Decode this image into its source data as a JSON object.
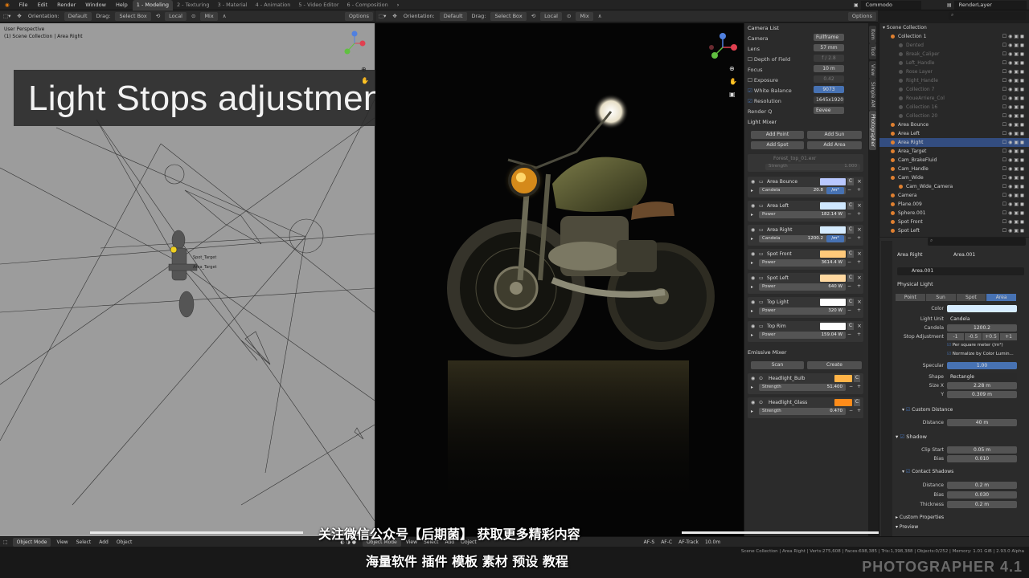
{
  "topbar": {
    "menus": [
      "File",
      "Edit",
      "Render",
      "Window",
      "Help"
    ],
    "tabs": [
      "1 - Modeling",
      "2 - Texturing",
      "3 - Material",
      "4 - Animation",
      "5 - Video Editor",
      "6 - Composition"
    ],
    "scene": "Commodo",
    "render_layer": "RenderLayer"
  },
  "viewport_header": {
    "orientation_label": "Orientation:",
    "orientation_value": "Default",
    "drag_label": "Drag:",
    "drag_value": "Select Box",
    "pivot_value": "Local",
    "snap_value": "Mix",
    "options": "Options"
  },
  "left_viewport": {
    "info_line1": "User Perspective",
    "info_line2": "(1) Scene Collection | Area Right",
    "target_label_1": "Spot_Target",
    "target_label_2": "Area_Target"
  },
  "overlay_title": "Light Stops adjustments",
  "camera_panel": {
    "camera_list": "Camera List",
    "camera_label": "Camera",
    "camera_value": "Fullframe",
    "lens_label": "Lens",
    "lens_value": "57 mm",
    "dof_label": "Depth of Field",
    "dof_value": "f / 2.8",
    "focus_label": "Focus",
    "focus_value": "10 m",
    "exposure_label": "Exposure",
    "exposure_value": "0.42",
    "wb_label": "White Balance",
    "wb_value": "9073",
    "resolution_label": "Resolution",
    "resolution_value": "1645x1920",
    "render_label": "Render Q",
    "render_value": "Eevee"
  },
  "light_mixer": {
    "title": "Light Mixer",
    "add_point": "Add Point",
    "add_sun": "Add Sun",
    "add_spot": "Add Spot",
    "add_area": "Add Area",
    "world_name": "Forest_top_01.exr",
    "world_strength_label": "Strength",
    "world_strength_value": "1.000",
    "lights": [
      {
        "name": "Area Bounce",
        "param": "Candela",
        "value": "20.8",
        "unit": "/m²",
        "color": "#b9c8ff"
      },
      {
        "name": "Area Left",
        "param": "Power",
        "value": "182.14 W",
        "unit": "",
        "color": "#cfe8ff"
      },
      {
        "name": "Area Right",
        "param": "Candela",
        "value": "1200.2",
        "unit": "/m²",
        "color": "#d6ecff"
      },
      {
        "name": "Spot Front",
        "param": "Power",
        "value": "3614.4 W",
        "unit": "",
        "color": "#ffc97a"
      },
      {
        "name": "Spot Left",
        "param": "Power",
        "value": "640 W",
        "unit": "",
        "color": "#ffd8a0"
      },
      {
        "name": "Top Light",
        "param": "Power",
        "value": "320 W",
        "unit": "",
        "color": "#ffffff"
      },
      {
        "name": "Top Rim",
        "param": "Power",
        "value": "159.04 W",
        "unit": "",
        "color": "#ffffff"
      }
    ]
  },
  "emissive_mixer": {
    "title": "Emissive Mixer",
    "scan": "Scan",
    "create": "Create",
    "items": [
      {
        "name": "Headlight_Bulb",
        "param": "Strength",
        "value": "51.400",
        "color": "#ffb347"
      },
      {
        "name": "Headlight_Glass",
        "param": "Strength",
        "value": "0.470",
        "color": "#ff8c1a"
      }
    ]
  },
  "side_tabs": [
    "Item",
    "Tool",
    "View",
    "Simple AM",
    "Photographer"
  ],
  "outliner": {
    "root": "Scene Collection",
    "rows": [
      {
        "name": "Collection 1",
        "dim": false,
        "sel": false,
        "lvl": 1
      },
      {
        "name": "Dented",
        "dim": true,
        "sel": false,
        "lvl": 2
      },
      {
        "name": "Break_Caliper",
        "dim": true,
        "sel": false,
        "lvl": 2
      },
      {
        "name": "Left_Handle",
        "dim": true,
        "sel": false,
        "lvl": 2
      },
      {
        "name": "Rose Layer",
        "dim": true,
        "sel": false,
        "lvl": 2
      },
      {
        "name": "Right_Handle",
        "dim": true,
        "sel": false,
        "lvl": 2
      },
      {
        "name": "Collection 7",
        "dim": true,
        "sel": false,
        "lvl": 2
      },
      {
        "name": "RoueArriere_Col",
        "dim": true,
        "sel": false,
        "lvl": 2
      },
      {
        "name": "Collection 16",
        "dim": true,
        "sel": false,
        "lvl": 2
      },
      {
        "name": "Collection 20",
        "dim": true,
        "sel": false,
        "lvl": 2
      },
      {
        "name": "Area Bounce",
        "dim": false,
        "sel": false,
        "lvl": 1
      },
      {
        "name": "Area Left",
        "dim": false,
        "sel": false,
        "lvl": 1
      },
      {
        "name": "Area Right",
        "dim": false,
        "sel": true,
        "lvl": 1
      },
      {
        "name": "Area_Target",
        "dim": false,
        "sel": false,
        "lvl": 1
      },
      {
        "name": "Cam_BrakeFluid",
        "dim": false,
        "sel": false,
        "lvl": 1
      },
      {
        "name": "Cam_Handle",
        "dim": false,
        "sel": false,
        "lvl": 1
      },
      {
        "name": "Cam_Wide",
        "dim": false,
        "sel": false,
        "lvl": 1
      },
      {
        "name": "Cam_Wide_Camera",
        "dim": false,
        "sel": false,
        "lvl": 2
      },
      {
        "name": "Camera",
        "dim": false,
        "sel": false,
        "lvl": 1
      },
      {
        "name": "Plane.009",
        "dim": false,
        "sel": false,
        "lvl": 1
      },
      {
        "name": "Sphere.001",
        "dim": false,
        "sel": false,
        "lvl": 1
      },
      {
        "name": "Spot Front",
        "dim": false,
        "sel": false,
        "lvl": 1
      },
      {
        "name": "Spot Left",
        "dim": false,
        "sel": false,
        "lvl": 1
      }
    ]
  },
  "properties": {
    "object_name": "Area Right",
    "data_name": "Area.001",
    "data_field": "Area.001",
    "physical_light": "Physical Light",
    "types": [
      "Point",
      "Sun",
      "Spot",
      "Area"
    ],
    "color_label": "Color",
    "light_unit_label": "Light Unit",
    "light_unit_value": "Candela",
    "candela_label": "Candela",
    "candela_value": "1200.2",
    "stop_label": "Stop Adjustment",
    "stops": [
      "-1",
      "-0.5",
      "+0.5",
      "+1"
    ],
    "per_sqm": "Per square meter (/m²)",
    "normalize": "Normalize by Color Lumin...",
    "specular_label": "Specular",
    "specular_value": "1.00",
    "shape_label": "Shape",
    "shape_value": "Rectangle",
    "sizex_label": "Size X",
    "sizex_value": "2.28 m",
    "y_label": "Y",
    "y_value": "0.309 m",
    "custom_distance": "Custom Distance",
    "distance_label": "Distance",
    "distance_value": "40 m",
    "shadow": "Shadow",
    "clip_label": "Clip Start",
    "clip_value": "0.05 m",
    "bias_label": "Bias",
    "bias_value": "0.010",
    "contact_shadows": "Contact Shadows",
    "c_distance_label": "Distance",
    "c_distance_value": "0.2 m",
    "c_bias_label": "Bias",
    "c_bias_value": "0.030",
    "thickness_label": "Thickness",
    "thickness_value": "0.2 m",
    "custom_props": "Custom Properties",
    "preview": "Preview"
  },
  "bottom_header": {
    "mode": "Object Mode",
    "menus": [
      "View",
      "Select",
      "Add",
      "Object"
    ],
    "af_s": "AF-S",
    "af_c": "AF-C",
    "af_track": "AF-Track",
    "af_dist": "10.0m"
  },
  "status_text": "Scene Collection | Area Right | Verts:275,608 | Faces:698,385 | Tris:1,398,388 | Objects:0/252 | Memory: 1.01 GiB | 2.93.0 Alpha",
  "subtitle_1": "关注微信公众号【后期菌】 获取更多精彩内容",
  "subtitle_2": "海量软件 插件 模板 素材 预设 教程",
  "watermark": "PHOTOGRAPHER 4.1",
  "colors": {
    "accent": "#4772b3",
    "selected_row": "#334d80",
    "viewport_bg": "#9c9c9c"
  }
}
